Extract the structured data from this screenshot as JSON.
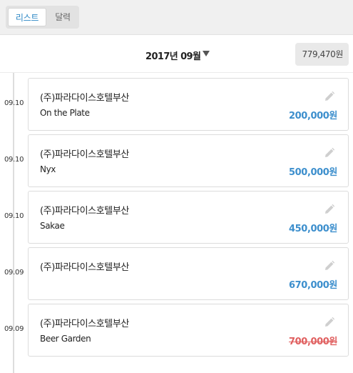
{
  "tabs": [
    {
      "label": "리스트",
      "active": true
    },
    {
      "label": "달력",
      "active": false
    }
  ],
  "month": {
    "label": "2017년 09월",
    "total": "779,470원"
  },
  "transactions": [
    {
      "date": "09.10",
      "merchant": "(주)파라다이스호텔부산",
      "memo": "On the Plate",
      "amount": "200,000원",
      "cancelled": false
    },
    {
      "date": "09.10",
      "merchant": "(주)파라다이스호텔부산",
      "memo": "Nyx",
      "amount": "500,000원",
      "cancelled": false
    },
    {
      "date": "09.10",
      "merchant": "(주)파라다이스호텔부산",
      "memo": "Sakae",
      "amount": "450,000원",
      "cancelled": false
    },
    {
      "date": "09.09",
      "merchant": "(주)파라다이스호텔부산",
      "memo": "",
      "amount": "670,000원",
      "cancelled": false
    },
    {
      "date": "09.09",
      "merchant": "(주)파라다이스호텔부산",
      "memo": "Beer Garden",
      "amount": "700,000원",
      "cancelled": true
    }
  ],
  "colors": {
    "accent": "#3d8fcd",
    "cancelled": "#e06060"
  },
  "icons": {
    "edit": "pencil-icon",
    "dropdown": "caret-down-icon"
  }
}
